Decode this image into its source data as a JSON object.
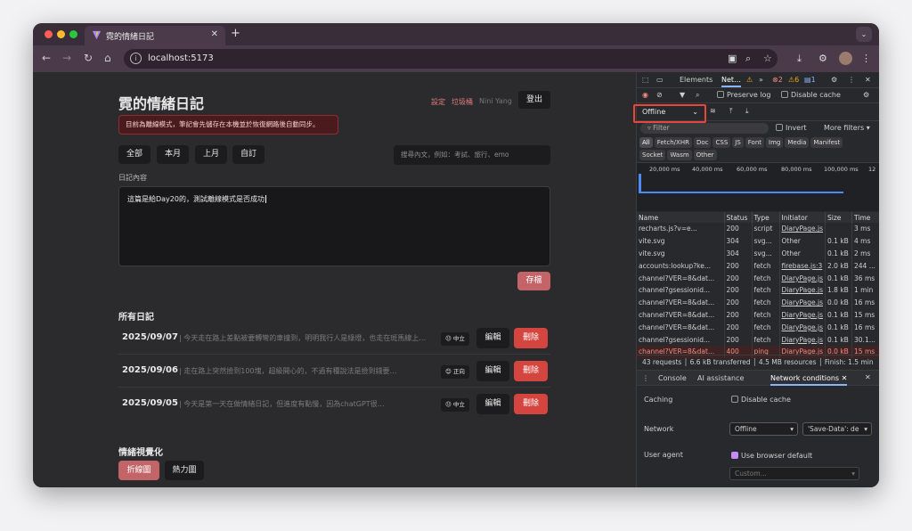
{
  "browser": {
    "tab_title": "霓的情緒日記",
    "url": "localhost:5173"
  },
  "app": {
    "title": "霓的情緒日記",
    "header_links": {
      "settings": "設定",
      "trash": "垃圾桶",
      "user": "Nini Yang",
      "logout": "登出"
    },
    "offline_banner": "目前為離線模式，筆記會先儲存在本機並於恢復網路後自動同步。",
    "filters": [
      "全部",
      "本月",
      "上月",
      "自訂"
    ],
    "search_placeholder": "搜尋內文，例如：考試、旅行、emo",
    "editor_label": "日記內容",
    "editor_value": "這篇是給Day20的，測試離線模式是否成功",
    "save_label": "存檔",
    "list_heading": "所有日記",
    "entries": [
      {
        "date": "2025/09/07",
        "preview": "| 今天走在路上差點被要轉彎的車撞到，明明我行人是綠燈，也走在斑馬線上…",
        "mood": "中立",
        "edit": "編輯",
        "delete": "刪除"
      },
      {
        "date": "2025/09/06",
        "preview": "| 走在路上突然撿到100塊，超級開心的，不過有種說法是撿到錢要…",
        "mood": "正向",
        "edit": "編輯",
        "delete": "刪除"
      },
      {
        "date": "2025/09/05",
        "preview": "| 今天是第一天在做情緒日記，但進度有點慢，因為chatGPT很…",
        "mood": "中立",
        "edit": "編輯",
        "delete": "刪除"
      }
    ],
    "viz_heading": "情緒視覺化",
    "viz_tabs": [
      "折線圖",
      "熱力圖"
    ]
  },
  "devtools": {
    "tabs": {
      "elements": "Elements",
      "network": "Net…"
    },
    "counts": {
      "errors": "2",
      "warnings": "6",
      "info": "1"
    },
    "preserve_log": "Preserve log",
    "disable_cache": "Disable cache",
    "throttle": "Offline",
    "filter_placeholder": "Filter",
    "invert": "Invert",
    "more_filters": "More filters",
    "type_chips": [
      "All",
      "Fetch/XHR",
      "Doc",
      "CSS",
      "JS",
      "Font",
      "Img",
      "Media",
      "Manifest",
      "Socket",
      "Wasm",
      "Other"
    ],
    "timeline_ticks": [
      "20,000 ms",
      "40,000 ms",
      "60,000 ms",
      "80,000 ms",
      "100,000 ms",
      "12"
    ],
    "columns": [
      "Name",
      "Status",
      "Type",
      "Initiator",
      "Size",
      "Time"
    ],
    "rows": [
      {
        "name": "recharts.js?v=e...",
        "status": "200",
        "type": "script",
        "initiator": "DiaryPage.js",
        "size": "",
        "time": "3 ms"
      },
      {
        "name": "vite.svg",
        "status": "304",
        "type": "svg...",
        "initiator": "Other",
        "size": "0.1 kB",
        "time": "4 ms"
      },
      {
        "name": "vite.svg",
        "status": "304",
        "type": "svg...",
        "initiator": "Other",
        "size": "0.1 kB",
        "time": "2 ms"
      },
      {
        "name": "accounts:lookup?ke...",
        "status": "200",
        "type": "fetch",
        "initiator": "firebase.js:3",
        "size": "2.0 kB",
        "time": "244 ..."
      },
      {
        "name": "channel?VER=8&dat...",
        "status": "200",
        "type": "fetch",
        "initiator": "DiaryPage.js",
        "size": "0.1 kB",
        "time": "36 ms"
      },
      {
        "name": "channel?gsessionid...",
        "status": "200",
        "type": "fetch",
        "initiator": "DiaryPage.js",
        "size": "1.8 kB",
        "time": "1 min"
      },
      {
        "name": "channel?VER=8&dat...",
        "status": "200",
        "type": "fetch",
        "initiator": "DiaryPage.js",
        "size": "0.0 kB",
        "time": "16 ms"
      },
      {
        "name": "channel?VER=8&dat...",
        "status": "200",
        "type": "fetch",
        "initiator": "DiaryPage.js",
        "size": "0.1 kB",
        "time": "15 ms"
      },
      {
        "name": "channel?VER=8&dat...",
        "status": "200",
        "type": "fetch",
        "initiator": "DiaryPage.js",
        "size": "0.1 kB",
        "time": "16 ms"
      },
      {
        "name": "channel?gsessionid...",
        "status": "200",
        "type": "fetch",
        "initiator": "DiaryPage.js",
        "size": "0.1 kB",
        "time": "30.1..."
      },
      {
        "name": "channel?VER=8&dat...",
        "status": "400",
        "type": "ping",
        "initiator": "DiaryPage.js",
        "size": "0.0 kB",
        "time": "15 ms"
      }
    ],
    "summary": [
      "43 requests",
      "6.6 kB transferred",
      "4.5 MB resources",
      "Finish: 1.5 min"
    ],
    "drawer_tabs": [
      "Console",
      "AI assistance",
      "Network conditions"
    ],
    "conditions": {
      "caching_label": "Caching",
      "caching_value": "Disable cache",
      "network_label": "Network",
      "network_value": "Offline",
      "save_data": "'Save-Data': de",
      "ua_label": "User agent",
      "ua_value": "Use browser default",
      "ua_custom": "Custom..."
    },
    "colors": {
      "error": "#f28b82",
      "highlight": "#e8453c"
    }
  }
}
